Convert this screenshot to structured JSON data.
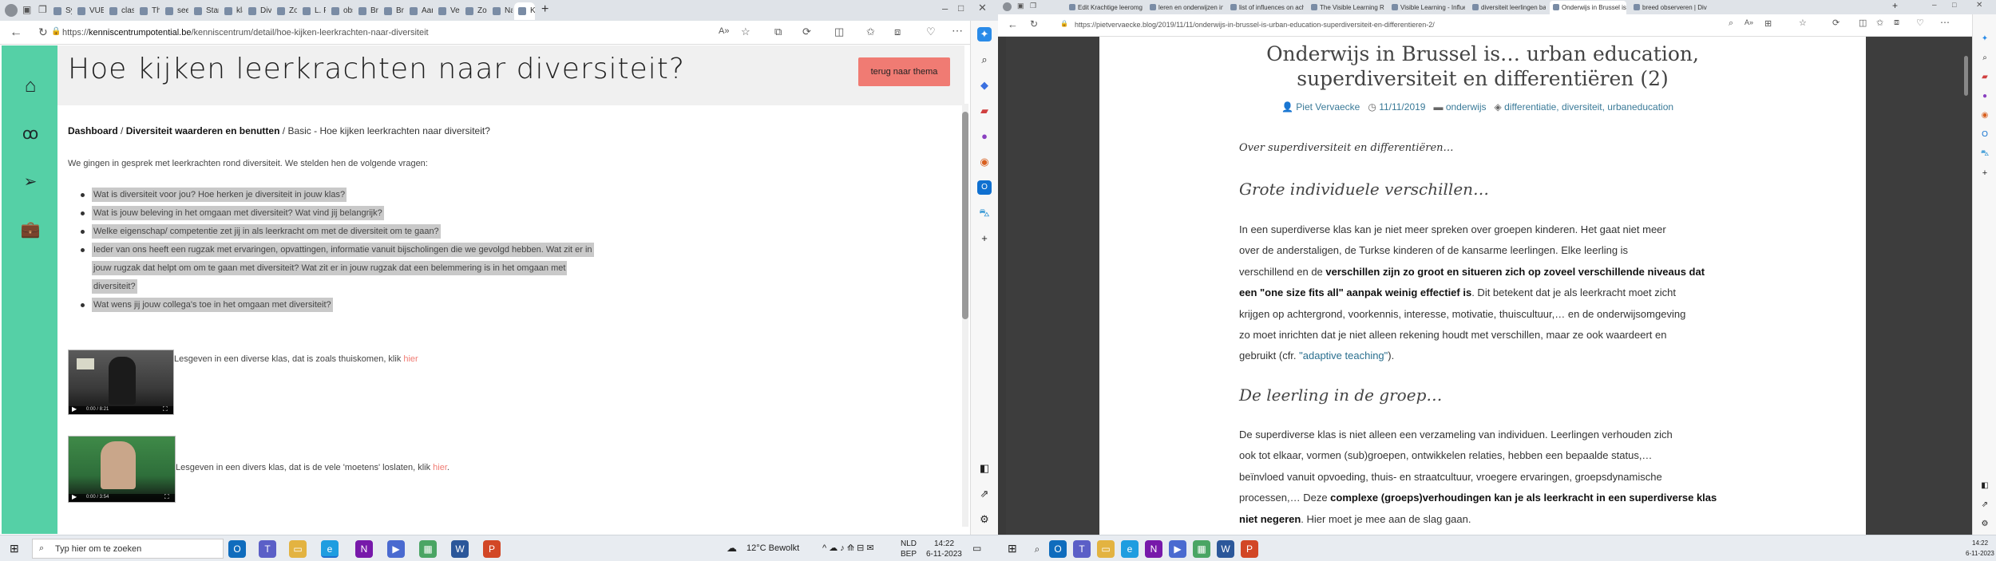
{
  "left_browser": {
    "tabs": [
      "Symb",
      "VUB",
      "class",
      "The I",
      "seein",
      "Start",
      "klass",
      "Dive",
      "Zo le",
      "L. Fo",
      "obse",
      "Bree",
      "Bree",
      "Aanc",
      "Vers",
      "Zoek",
      "Naar",
      "K"
    ],
    "url_prefix": "https://",
    "url_host": "kenniscentrumpotential.be",
    "url_path": "/kenniscentrum/detail/hoe-kijken-leerkrachten-naar-diversiteit"
  },
  "left_page": {
    "title": "Hoe kijken leerkrachten naar diversiteit?",
    "theme_button": "terug naar thema",
    "breadcrumb": {
      "crumb1": "Dashboard",
      "sep1": " / ",
      "crumb2": "Diversiteit waarderen en benutten",
      "sep2": " / ",
      "crumb3": "Basic - Hoe kijken leerkrachten naar diversiteit?"
    },
    "intro": "We gingen in gesprek met leerkrachten rond diversiteit. We stelden hen de volgende vragen:",
    "questions": {
      "q1": "Wat is diversiteit voor jou? Hoe herken je diversiteit in jouw klas?",
      "q2": "Wat is jouw beleving in het omgaan met diversiteit? Wat vind jij belangrijk?",
      "q3": "Welke eigenschap/ competentie zet jij in als leerkracht om met de diversiteit om te gaan?",
      "q4a": "Ieder van ons heeft een rugzak met ervaringen, opvattingen,  informatie vanuit bijscholingen die we gevolgd hebben. Wat zit er in",
      "q4b": "jouw rugzak dat helpt om om te gaan met diversiteit? Wat zit er in jouw rugzak dat een belemmering is in het omgaan met",
      "q4c": "diversiteit?",
      "q5": "Wat wens jij jouw collega's toe in het omgaan met diversiteit?"
    },
    "video1": {
      "caption": "Lesgeven in een diverse klas,  dat is zoals thuiskomen, klik ",
      "link": "hier",
      "time": "0:00 / 8:21"
    },
    "video2": {
      "caption": "Lesgeven in een divers klas, dat is de vele 'moetens' loslaten, klik ",
      "link": "hier",
      "end": ".",
      "time": "0:00 / 3:54"
    }
  },
  "right_browser": {
    "tabs": [
      "Edit Krachtige leeromgev",
      "leren en onderwijzen in",
      "list of influences on achie",
      "The Visible Learning Rese",
      "Visible Learning - Influe",
      "diversiteit leerlingen bas",
      "Onderwijs in Brussel is...",
      "breed observeren | Diva"
    ],
    "url": "https://pietvervaecke.blog/2019/11/11/onderwijs-in-brussel-is-urban-education-superdiversiteit-en-differentieren-2/"
  },
  "blog": {
    "title_line1": "Onderwijs in Brussel is… urban education,",
    "title_line2": "superdiversiteit en differentiëren (2)",
    "author": "Piet Vervaecke",
    "date": "11/11/2019",
    "category": "onderwijs",
    "tags": "differentiatie, diversiteit, urbaneducation",
    "lead": "Over superdiversiteit en differentiëren…",
    "h1": "Grote individuele verschillen…",
    "p1": {
      "l1": "In een superdiverse klas kan je niet meer spreken over groepen kinderen.  Het gaat niet meer",
      "l2": "over de anderstaligen,  de Turkse kinderen of de kansarme leerlingen.  Elke leerling is",
      "l3a": "verschillend en de ",
      "l3b": "verschillen zijn zo groot en situeren zich op zoveel verschillende niveaus dat",
      "l4b": "een \"one size fits all\" aanpak weinig effectief is",
      "l4c": ". Dit betekent dat je als leerkracht moet zicht",
      "l5": "krijgen op achtergrond, voorkennis, interesse, motivatie, thuiscultuur,… en de onderwijsomgeving",
      "l6": "zo moet inrichten dat je niet alleen rekening houdt met verschillen, maar ze ook waardeert en",
      "l7a": "gebruikt (cfr. ",
      "l7link": "\"adaptive teaching\"",
      "l7b": ")."
    },
    "h2": "De leerling in de groep…",
    "p2": {
      "l1": "De superdiverse klas is niet alleen een verzameling van individuen.  Leerlingen verhouden zich",
      "l2": "ook tot elkaar, vormen (sub)groepen, ontwikkelen relaties, hebben een bepaalde status,…",
      "l3": "beïnvloed vanuit opvoeding, thuis- en straatcultuur, vroegere ervaringen, groepsdynamische",
      "l4a": "processen,… Deze ",
      "l4b": "complexe (groeps)verhoudingen kan je als leerkracht in een superdiverse klas",
      "l5b": "niet negeren",
      "l5c": ".  Hier moet je mee aan de slag gaan."
    }
  },
  "taskbar_left": {
    "search": "Typ hier om te zoeken",
    "weather": "12°C  Bewolkt",
    "lang1": "NLD",
    "lang2": "BEP",
    "time": "14:22",
    "date": "6-11-2023"
  },
  "taskbar_right": {
    "time": "14:22",
    "date": "6-11-2023"
  },
  "colors": {
    "sidebar": "#55d0a6",
    "accent_button": "#f07b73",
    "link_blue": "#2a6f8f"
  }
}
